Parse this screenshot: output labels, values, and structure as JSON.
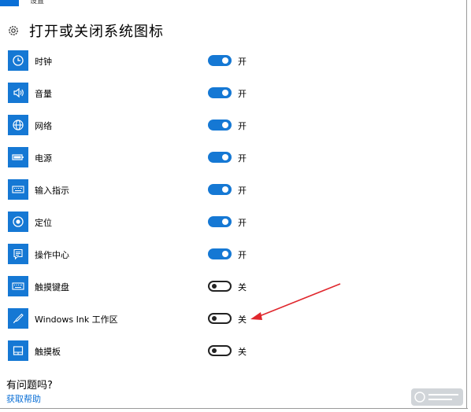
{
  "window": {
    "title": "设置"
  },
  "page": {
    "title": "打开或关闭系统图标"
  },
  "icons": [
    {
      "label": "时钟",
      "icon": "clock-icon",
      "state": "开",
      "on": true
    },
    {
      "label": "音量",
      "icon": "volume-icon",
      "state": "开",
      "on": true
    },
    {
      "label": "网络",
      "icon": "network-globe-icon",
      "state": "开",
      "on": true
    },
    {
      "label": "电源",
      "icon": "battery-icon",
      "state": "开",
      "on": true
    },
    {
      "label": "输入指示",
      "icon": "keyboard-icon",
      "state": "开",
      "on": true
    },
    {
      "label": "定位",
      "icon": "location-icon",
      "state": "开",
      "on": true
    },
    {
      "label": "操作中心",
      "icon": "action-center-icon",
      "state": "开",
      "on": true
    },
    {
      "label": "触摸键盘",
      "icon": "touch-keyboard-icon",
      "state": "关",
      "on": false
    },
    {
      "label": "Windows Ink 工作区",
      "icon": "pen-icon",
      "state": "关",
      "on": false
    },
    {
      "label": "触摸板",
      "icon": "touchpad-icon",
      "state": "关",
      "on": false
    }
  ],
  "help": {
    "question": "有问题吗?",
    "link": "获取帮助"
  },
  "colors": {
    "accent": "#1578d4",
    "annotation_arrow": "#e0272d"
  }
}
